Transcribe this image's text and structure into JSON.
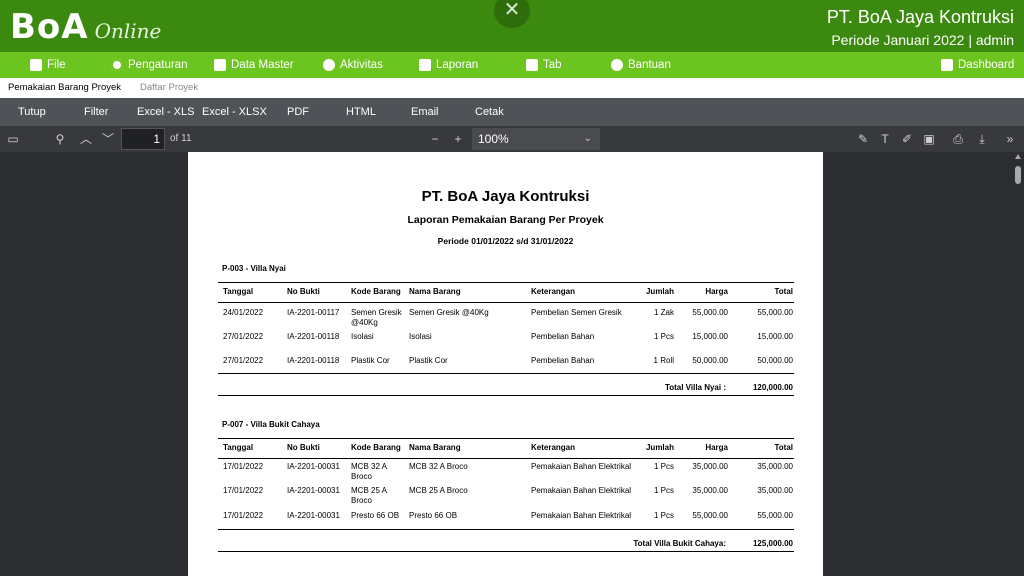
{
  "header": {
    "logo_text": "BoA",
    "logo_sub": "Online",
    "close_glyph": "✕",
    "company": "PT. BoA Jaya Kontruksi",
    "period_user": "Periode Januari 2022 | admin"
  },
  "menu": [
    {
      "label": "File",
      "icon": "file-icon"
    },
    {
      "label": "Pengaturan",
      "icon": "gear-icon"
    },
    {
      "label": "Data Master",
      "icon": "database-icon"
    },
    {
      "label": "Aktivitas",
      "icon": "activity-icon"
    },
    {
      "label": "Laporan",
      "icon": "report-icon"
    },
    {
      "label": "Tab",
      "icon": "tab-icon"
    },
    {
      "label": "Bantuan",
      "icon": "help-icon"
    },
    {
      "label": "Dashboard",
      "icon": "chart-icon"
    }
  ],
  "tabs": [
    {
      "label": "Pemakaian Barang Proyek",
      "active": true
    },
    {
      "label": "Daftar Proyek",
      "active": false
    }
  ],
  "actions": [
    "Tutup",
    "Filter",
    "Excel - XLS",
    "Excel - XLSX",
    "PDF",
    "HTML",
    "Email",
    "Cetak"
  ],
  "pdf": {
    "page_current": "1",
    "page_total": "of 11",
    "zoom": "100%"
  },
  "report": {
    "title": "PT. BoA Jaya Kontruksi",
    "subtitle": "Laporan Pemakaian Barang Per Proyek",
    "period": "Periode 01/01/2022 s/d 31/01/2022",
    "columns": [
      "Tanggal",
      "No Bukti",
      "Kode Barang",
      "Nama Barang",
      "Keterangan",
      "Jumlah",
      "Harga",
      "Total"
    ],
    "groups": [
      {
        "title": "P-003 - Villa Nyai",
        "rows": [
          {
            "tanggal": "24/01/2022",
            "no_bukti": "IA-2201-00117",
            "kode": "Semen Gresik @40Kg",
            "nama": "Semen Gresik @40Kg",
            "keterangan": "Pembelian Semen Gresik",
            "jumlah": "1 Zak",
            "harga": "55,000.00",
            "total": "55,000.00"
          },
          {
            "tanggal": "27/01/2022",
            "no_bukti": "IA-2201-00118",
            "kode": "Isolasi",
            "nama": "Isolasi",
            "keterangan": "Pembelian Bahan",
            "jumlah": "1 Pcs",
            "harga": "15,000.00",
            "total": "15,000.00"
          },
          {
            "tanggal": "27/01/2022",
            "no_bukti": "IA-2201-00118",
            "kode": "Plastik Cor",
            "nama": "Plastik Cor",
            "keterangan": "Pembelian Bahan",
            "jumlah": "1 Roll",
            "harga": "50,000.00",
            "total": "50,000.00"
          }
        ],
        "total_label": "Total  Villa Nyai :",
        "total_value": "120,000.00"
      },
      {
        "title": "P-007 - Villa Bukit Cahaya",
        "rows": [
          {
            "tanggal": "17/01/2022",
            "no_bukti": "IA-2201-00031",
            "kode": "MCB 32 A Broco",
            "nama": "MCB 32 A Broco",
            "keterangan": "Pemakaian Bahan Elektrikal",
            "jumlah": "1 Pcs",
            "harga": "35,000.00",
            "total": "35,000.00"
          },
          {
            "tanggal": "17/01/2022",
            "no_bukti": "IA-2201-00031",
            "kode": "MCB 25 A Broco",
            "nama": "MCB 25 A Broco",
            "keterangan": "Pemakaian Bahan Elektrikal",
            "jumlah": "1 Pcs",
            "harga": "35,000.00",
            "total": "35,000.00"
          },
          {
            "tanggal": "17/01/2022",
            "no_bukti": "IA-2201-00031",
            "kode": "Presto 66 OB",
            "nama": "Presto 66 OB",
            "keterangan": "Pemakaian Bahan Elektrikal",
            "jumlah": "1 Pcs",
            "harga": "55,000.00",
            "total": "55,000.00"
          }
        ],
        "total_label": "Total  Villa Bukit Cahaya:",
        "total_value": "125,000.00"
      }
    ]
  }
}
